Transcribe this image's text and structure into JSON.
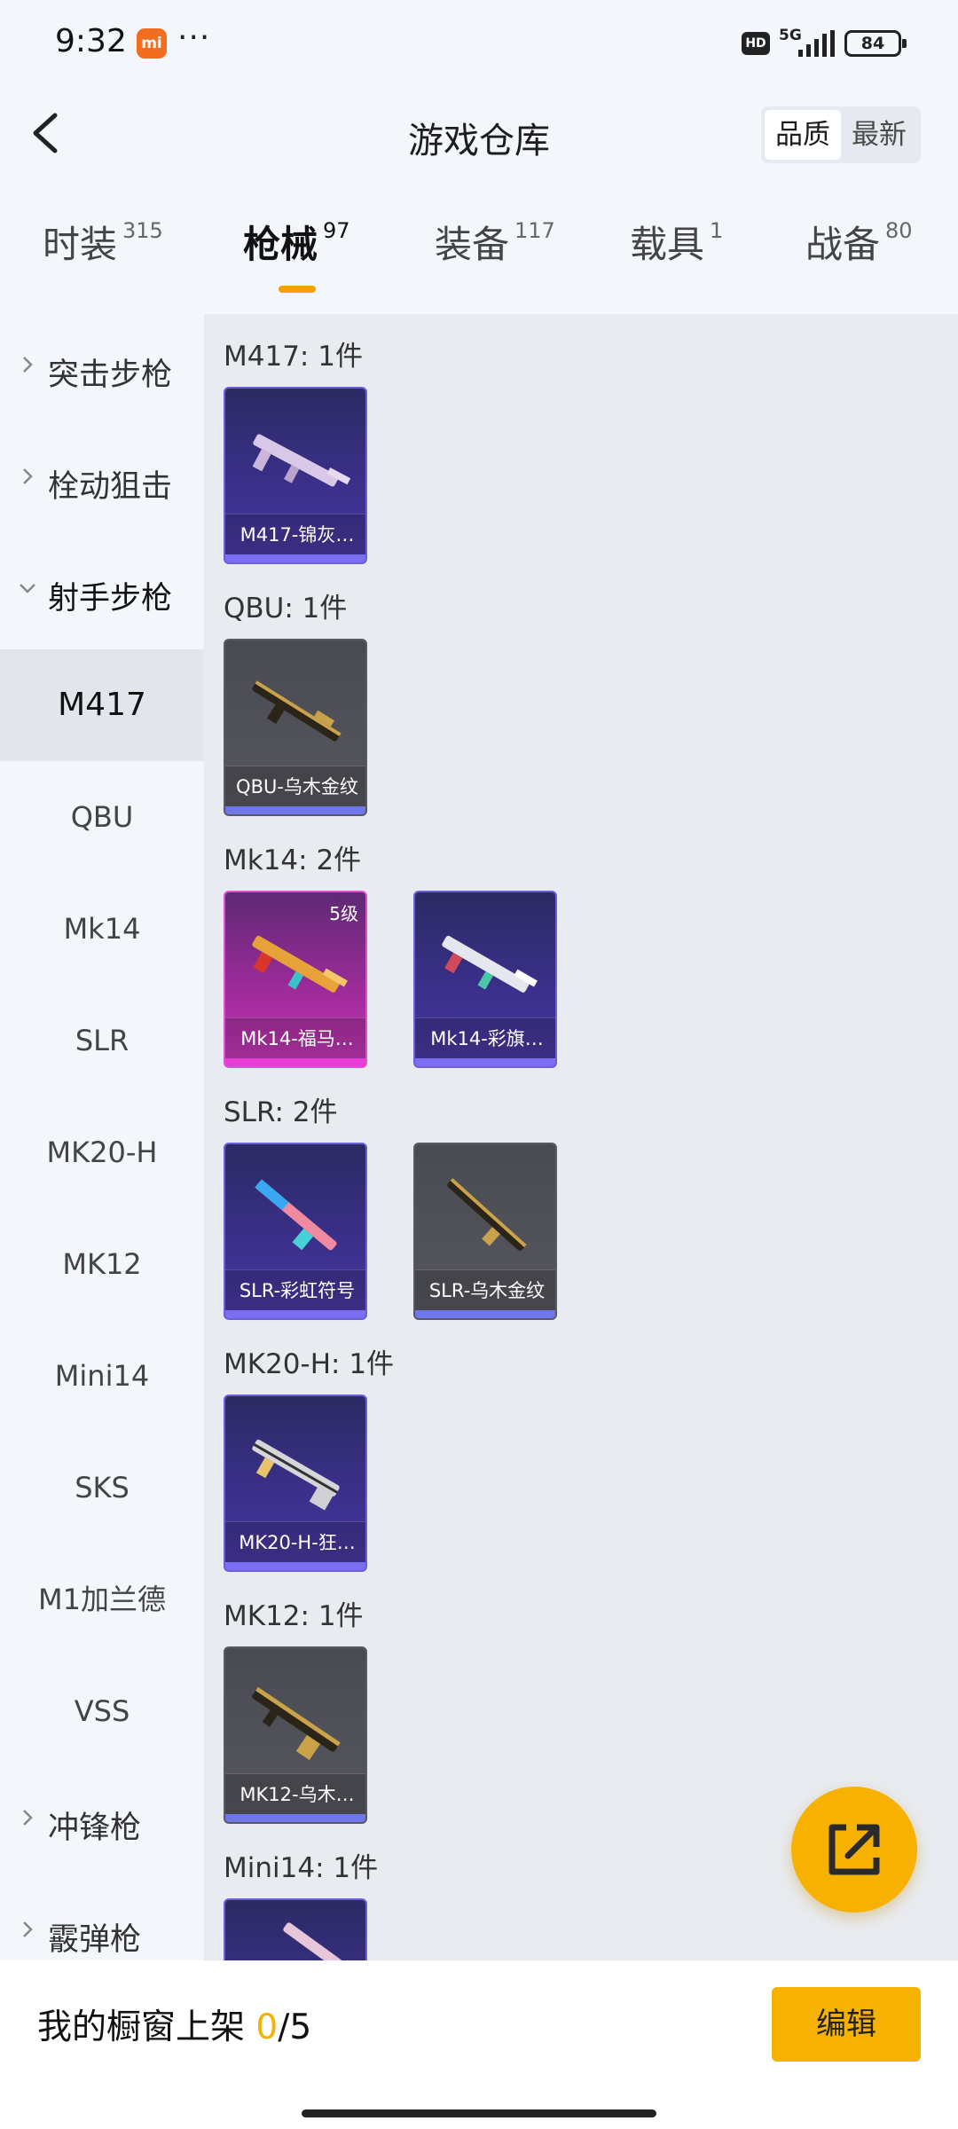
{
  "status_bar": {
    "time": "9:32",
    "mi_badge": "mi",
    "more": "···",
    "hd_badge": "HD",
    "network": "5G",
    "battery": "84"
  },
  "header": {
    "title": "游戏仓库",
    "sort_options": [
      "品质",
      "最新"
    ],
    "active_sort": "品质"
  },
  "category_tabs": [
    {
      "label": "时装",
      "count": "315"
    },
    {
      "label": "枪械",
      "count": "97"
    },
    {
      "label": "装备",
      "count": "117"
    },
    {
      "label": "载具",
      "count": "1"
    },
    {
      "label": "战备",
      "count": "80"
    }
  ],
  "active_tab": "枪械",
  "sidebar": {
    "groups": [
      {
        "label": "突击步枪",
        "expanded": false
      },
      {
        "label": "栓动狙击",
        "expanded": false
      },
      {
        "label": "射手步枪",
        "expanded": true
      },
      {
        "label": "冲锋枪",
        "expanded": false
      },
      {
        "label": "霰弹枪",
        "expanded": false
      }
    ],
    "items": [
      "M417",
      "QBU",
      "Mk14",
      "SLR",
      "MK20-H",
      "MK12",
      "Mini14",
      "SKS",
      "M1加兰德",
      "VSS"
    ],
    "active_item": "M417"
  },
  "sections": [
    {
      "title": "M417: 1件",
      "cards": [
        {
          "name": "M417-锦灰…",
          "quality": "purple"
        }
      ]
    },
    {
      "title": "QBU: 1件",
      "cards": [
        {
          "name": "QBU-乌木金纹",
          "quality": "grey"
        }
      ]
    },
    {
      "title": "Mk14: 2件",
      "cards": [
        {
          "name": "Mk14-福马…",
          "quality": "pink",
          "level": "5级"
        },
        {
          "name": "Mk14-彩旗…",
          "quality": "purple"
        }
      ]
    },
    {
      "title": "SLR: 2件",
      "cards": [
        {
          "name": "SLR-彩虹符号",
          "quality": "purple"
        },
        {
          "name": "SLR-乌木金纹",
          "quality": "grey"
        }
      ]
    },
    {
      "title": "MK20-H: 1件",
      "cards": [
        {
          "name": "MK20-H-狂…",
          "quality": "purple"
        }
      ]
    },
    {
      "title": "MK12: 1件",
      "cards": [
        {
          "name": "MK12-乌木…",
          "quality": "grey"
        }
      ]
    },
    {
      "title": "Mini14: 1件",
      "cards": [
        {
          "name": "",
          "quality": "purple"
        }
      ]
    }
  ],
  "footer": {
    "showcase_label": "我的橱窗上架",
    "showcase_current": "0",
    "showcase_total": "/5",
    "edit_label": "编辑"
  },
  "colors": {
    "accent": "#f7b100",
    "purple_quality": "#7b6ef2",
    "pink_quality": "#e93bd5",
    "grey_quality": "#6f78ea"
  },
  "icons": [
    "back-icon",
    "chevron-right-icon",
    "chevron-down-icon",
    "share-icon",
    "signal-icon",
    "battery-icon"
  ]
}
